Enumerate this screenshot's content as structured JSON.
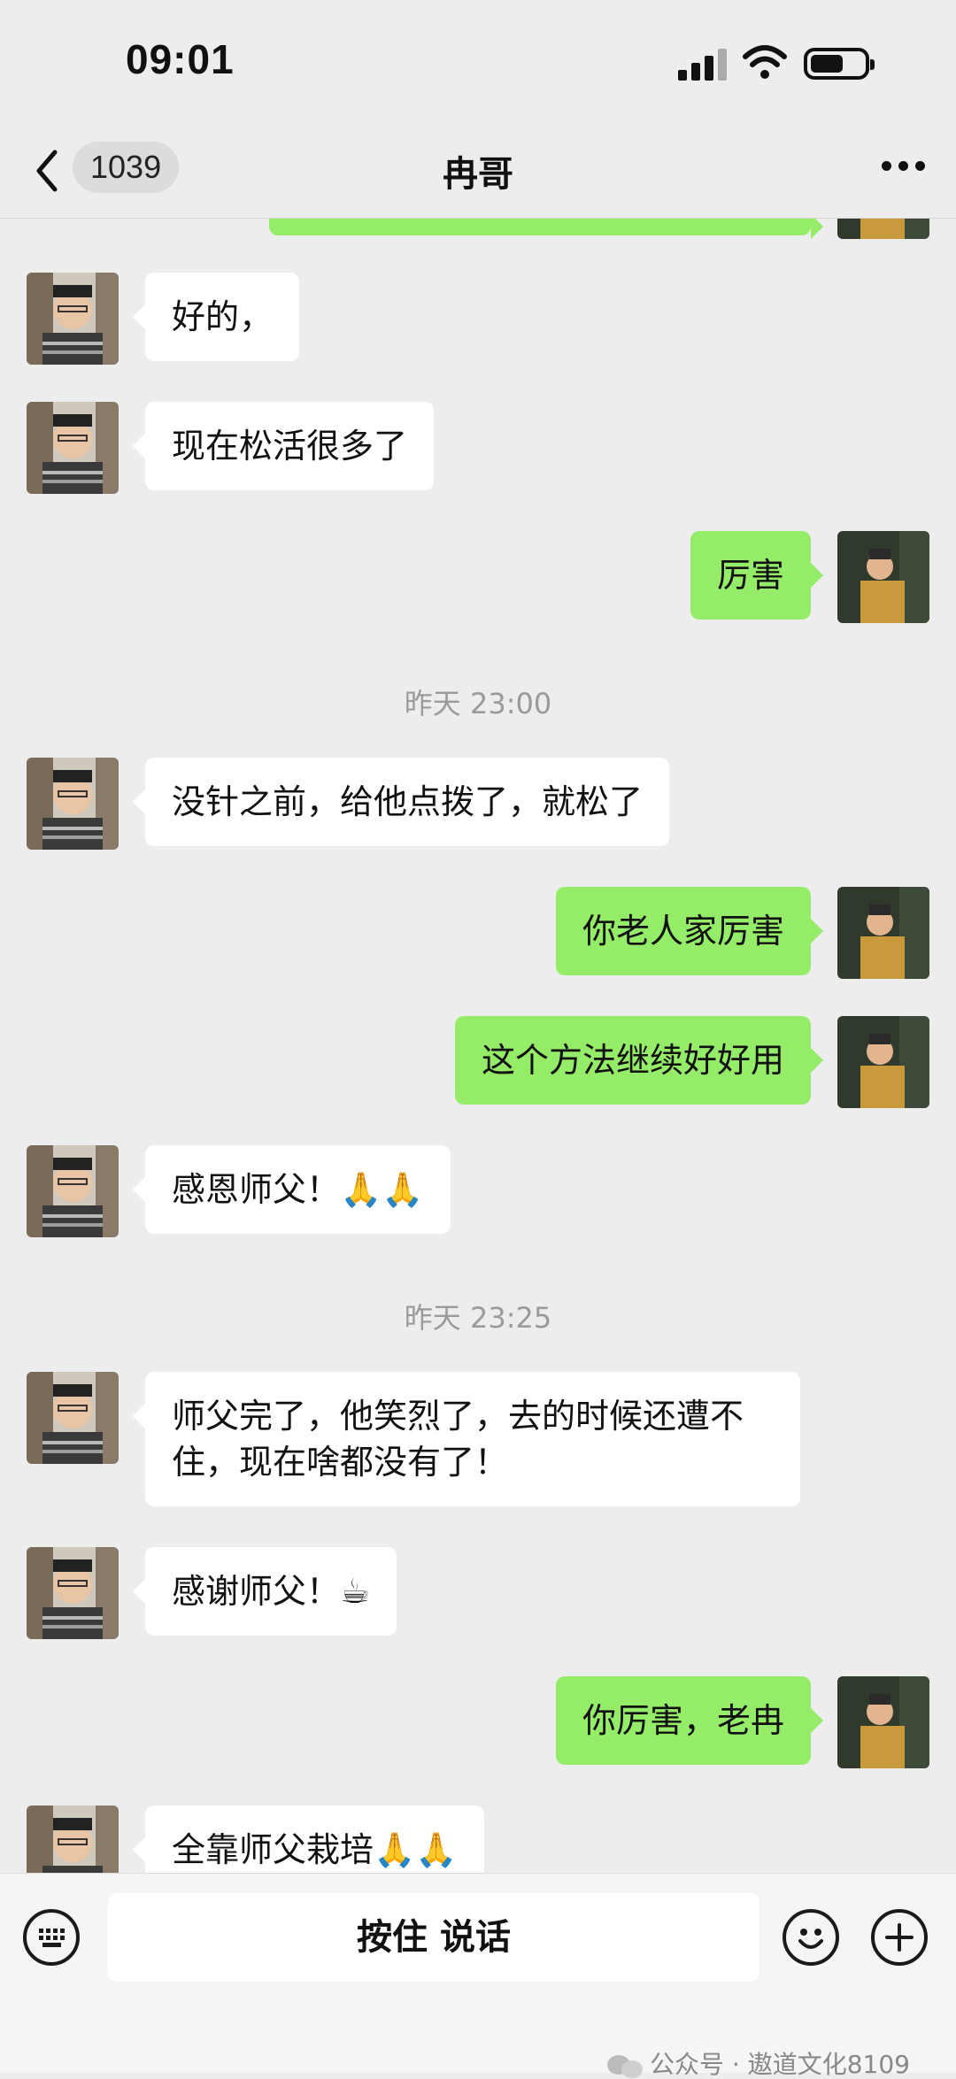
{
  "status_bar": {
    "time": "09:01"
  },
  "nav": {
    "back_count": "1039",
    "title": "冉哥"
  },
  "messages": [
    {
      "side": "left",
      "text": "好的，"
    },
    {
      "side": "left",
      "text": "现在松活很多了"
    },
    {
      "side": "right",
      "text": "厉害"
    },
    {
      "timestamp": "昨天 23:00"
    },
    {
      "side": "left",
      "text": "没针之前，给他点拨了，就松了"
    },
    {
      "side": "right",
      "text": "你老人家厉害"
    },
    {
      "side": "right",
      "text": "这个方法继续好好用"
    },
    {
      "side": "left",
      "text": "感恩师父！🙏🙏"
    },
    {
      "timestamp": "昨天 23:25"
    },
    {
      "side": "left",
      "text": "师父完了，他笑烈了，去的时候还遭不住，现在啥都没有了！"
    },
    {
      "side": "left",
      "text": "感谢师父！☕"
    },
    {
      "side": "right",
      "text": "你厉害，老冉"
    },
    {
      "side": "left",
      "text": "全靠师父栽培🙏🙏"
    }
  ],
  "input": {
    "talk_label": "按住 说话"
  },
  "watermark": "公众号 · 遨道文化8109",
  "colors": {
    "background": "#ededed",
    "outgoing_bubble": "#95ec69",
    "incoming_bubble": "#ffffff"
  }
}
